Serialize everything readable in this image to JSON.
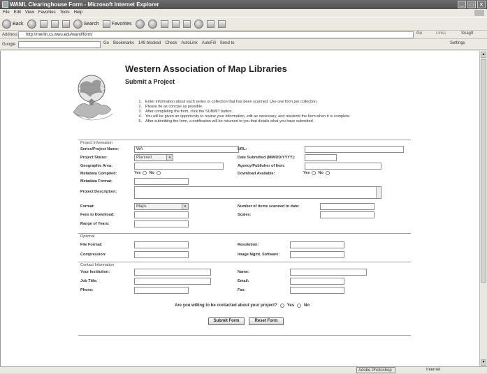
{
  "window": {
    "title": "WAML Clearinghouse Form - Microsoft Internet Explorer",
    "min_label": "_",
    "max_label": "□",
    "close_label": "×"
  },
  "menu": [
    "File",
    "Edit",
    "View",
    "Favorites",
    "Tools",
    "Help"
  ],
  "toolbar": {
    "back": "Back",
    "search": "Search",
    "favorites": "Favorites"
  },
  "address": {
    "label": "Address",
    "url": "http://merlin.cs.wwu.edu/waml/form/",
    "go": "Go",
    "links": "Links",
    "snagit": "SnagIt"
  },
  "google_bar": {
    "label": "Google",
    "go": "Go",
    "bookmarks": "Bookmarks",
    "blocked": "149 blocked",
    "check": "Check",
    "autolink": "AutoLink",
    "autofill": "AutoFill",
    "sendto": "Send to",
    "settings": "Settings"
  },
  "page": {
    "title": "Western Association of Map Libraries",
    "subtitle": "Submit a Project",
    "instructions": [
      {
        "num": "1.",
        "text": "Enter information about each series or collection that has been scanned. Use one form per collection."
      },
      {
        "num": "2.",
        "text": "Please be as concise as possible."
      },
      {
        "num": "3.",
        "text": "After completing the form, click the SUBMIT button."
      },
      {
        "num": "4.",
        "text": "You will be given an opportunity to review your information, edit as necessary, and resubmit the form when it is complete."
      },
      {
        "num": "5.",
        "text": "After submitting the form, a notification will be returned to you that details what you have submitted."
      }
    ]
  },
  "project_info": {
    "section_label": "Project Information",
    "series_name_label": "Series/Project Name:",
    "series_name_value": "WA",
    "url_label": "URL:",
    "status_label": "Project Status:",
    "status_value": "Planned",
    "date_label": "Date Submitted (MM/DD/YYYY):",
    "geo_label": "Geographic Area:",
    "agency_label": "Agency/Publisher of Item:",
    "metadata_compiled_label": "Metadata Compiled:",
    "download_label": "Download Available:",
    "yes": "Yes",
    "no": "No",
    "metadata_format_label": "Metadata Format:",
    "description_label": "Project Description:",
    "format_label": "Format:",
    "format_value": "Maps",
    "num_items_label": "Number of items scanned to date:",
    "fees_label": "Fees to Download:",
    "scales_label": "Scales:",
    "range_label": "Range of Years:"
  },
  "optional": {
    "section_label": "Optional",
    "file_format_label": "File Format:",
    "resolution_label": "Resolution:",
    "compression_label": "Compression:",
    "image_mgmt_label": "Image Mgmt. Software:"
  },
  "contact": {
    "section_label": "Contact Information",
    "institution_label": "Your Institution:",
    "name_label": "Name:",
    "job_label": "Job Title:",
    "email_label": "Email:",
    "phone_label": "Phone:",
    "fax_label": "Fax:"
  },
  "willing": {
    "question": "Are you willing to be contacted about your project?",
    "yes": "Yes",
    "no": "No"
  },
  "buttons": {
    "submit": "Submit Form",
    "reset": "Reset Form"
  },
  "status_bar": {
    "adobe": "Adobe Photoshop",
    "zone": "Internet"
  }
}
